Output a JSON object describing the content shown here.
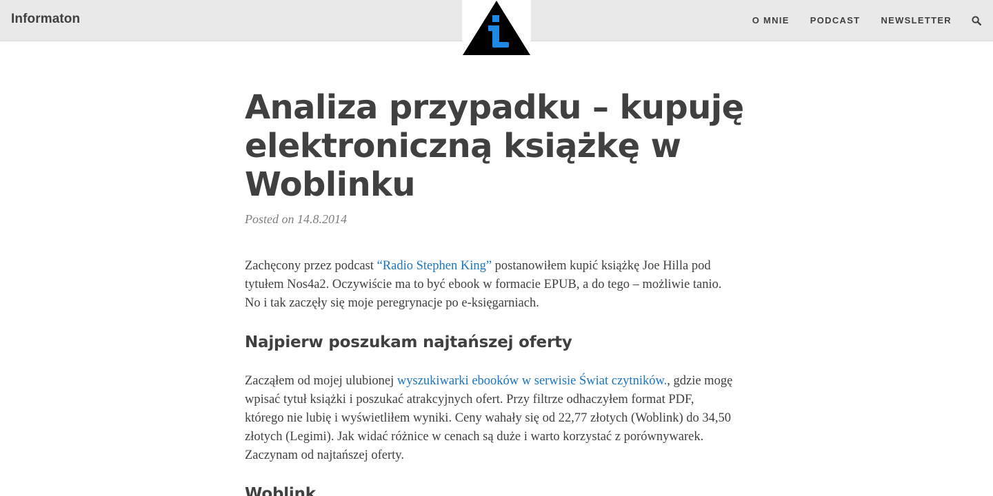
{
  "site": {
    "brand": "Informaton"
  },
  "nav": {
    "items": [
      {
        "label": "O MNIE"
      },
      {
        "label": "PODCAST"
      },
      {
        "label": "NEWSLETTER"
      }
    ],
    "search_icon": "search-icon"
  },
  "logo": {
    "icon": "info-triangle-logo",
    "colors": {
      "triangle": "#000000",
      "glyph": "#1e88e5"
    }
  },
  "article": {
    "title": "Analiza przypadku – kupuję elektroniczną książkę w Woblinku",
    "meta": "Posted on 14.8.2014",
    "p1": {
      "before": "Zachęcony przez podcast ",
      "link": "“Radio Stephen King”",
      "after": " postanowiłem kupić książkę Joe Hilla pod tytułem Nos4a2. Oczywiście ma to być ebook w formacie EPUB, a do tego – możliwie tanio. No i tak zaczęły się moje peregrynacje po e-księgarniach."
    },
    "h2_1": "Najpierw poszukam najtańszej oferty",
    "p2": {
      "before": "Zacząłem od mojej ulubionej ",
      "link": "wyszukiwarki ebooków w serwisie Świat czytników.",
      "after": ", gdzie mogę wpisać tytuł książki i poszukać atrakcyjnych ofert. Przy filtrze odhaczyłem format PDF, którego nie lubię i wyświetliłem wyniki. Ceny wahały się od 22,77 złotych (Woblink) do 34,50 złotych (Legimi). Jak widać różnice w cenach są duże i warto korzystać z porównywarek. Zaczynam od najtańszej oferty."
    },
    "h2_2": "Woblink"
  },
  "colors": {
    "topbar": "#e9e9e9",
    "text": "#404040",
    "link": "#1a75c0",
    "meta": "#808080"
  }
}
